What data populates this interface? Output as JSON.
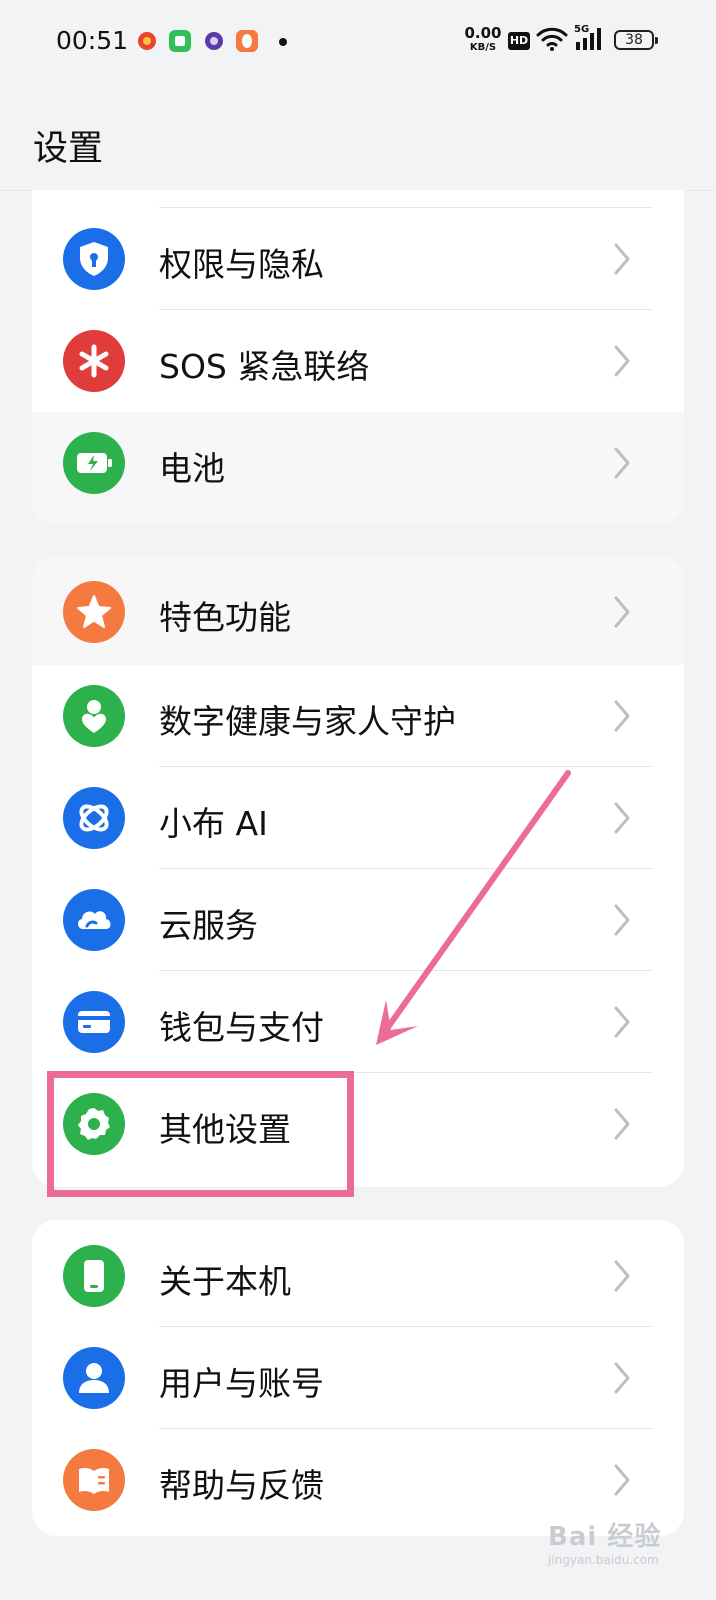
{
  "status_bar": {
    "time": "00:51",
    "net_speed": "0.00",
    "net_unit": "KB/S",
    "hd_label": "HD",
    "signal_label": "5G",
    "battery": "38"
  },
  "page_title": "设置",
  "groups": [
    {
      "items": [
        {
          "label": "权限与隐私",
          "icon": "shield-icon",
          "color": "#1a6fe8"
        },
        {
          "label": "SOS 紧急联络",
          "icon": "asterisk-icon",
          "color": "#e03c3c"
        },
        {
          "label": "电池",
          "icon": "battery-icon",
          "color": "#2db14d"
        }
      ]
    },
    {
      "items": [
        {
          "label": "特色功能",
          "icon": "star-icon",
          "color": "#f47a40"
        },
        {
          "label": "数字健康与家人守护",
          "icon": "person-heart-icon",
          "color": "#2db14d"
        },
        {
          "label": "小布 AI",
          "icon": "ai-assistant-icon",
          "color": "#1a6fe8"
        },
        {
          "label": "云服务",
          "icon": "cloud-icon",
          "color": "#1a6fe8"
        },
        {
          "label": "钱包与支付",
          "icon": "wallet-card-icon",
          "color": "#1a6fe8"
        },
        {
          "label": "其他设置",
          "icon": "gear-icon",
          "color": "#2db14d"
        }
      ]
    },
    {
      "items": [
        {
          "label": "关于本机",
          "icon": "phone-icon",
          "color": "#2db14d"
        },
        {
          "label": "用户与账号",
          "icon": "user-icon",
          "color": "#1a6fe8"
        },
        {
          "label": "帮助与反馈",
          "icon": "book-icon",
          "color": "#f47a40"
        }
      ]
    }
  ],
  "highlight_color": "#ec6b97",
  "watermark": {
    "main": "Bai 经验",
    "sub": "jingyan.baidu.com"
  }
}
